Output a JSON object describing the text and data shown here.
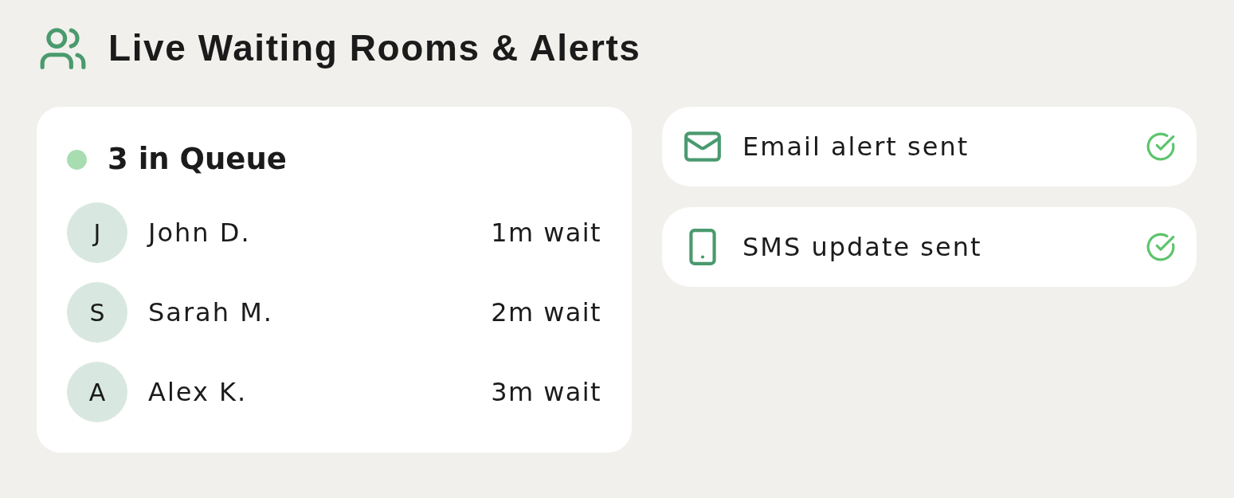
{
  "header": {
    "title": "Live Waiting Rooms & Alerts"
  },
  "queue": {
    "title": "3 in Queue",
    "patients": [
      {
        "initial": "J",
        "name": "John D.",
        "wait": "1m wait"
      },
      {
        "initial": "S",
        "name": "Sarah M.",
        "wait": "2m wait"
      },
      {
        "initial": "A",
        "name": "Alex K.",
        "wait": "3m wait"
      }
    ]
  },
  "alerts": [
    {
      "kind": "email",
      "label": "Email alert sent",
      "sent": true
    },
    {
      "kind": "sms",
      "label": "SMS update sent",
      "sent": true
    }
  ]
}
